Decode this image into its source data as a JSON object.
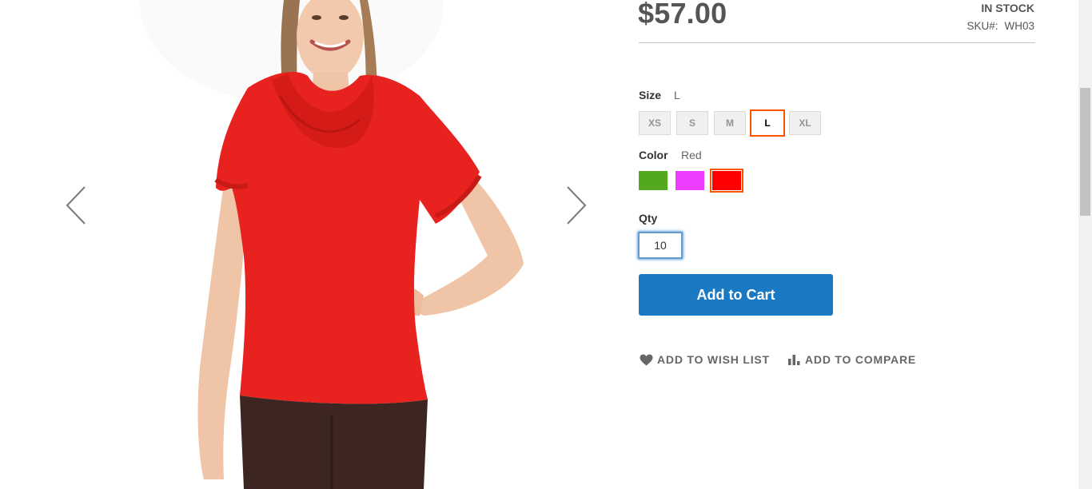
{
  "product": {
    "price": "$57.00",
    "stock_status": "IN STOCK",
    "sku_label": "SKU#:",
    "sku_value": "WH03"
  },
  "gallery": {
    "image_subject": "woman-red-cowl-neck-top",
    "prev_icon": "chevron-left-icon",
    "next_icon": "chevron-right-icon"
  },
  "options": {
    "size": {
      "label": "Size",
      "selected": "L",
      "choices": [
        "XS",
        "S",
        "M",
        "L",
        "XL"
      ]
    },
    "color": {
      "label": "Color",
      "selected": "Red",
      "choices": [
        {
          "name": "green",
          "hex": "#53a81e"
        },
        {
          "name": "purple",
          "hex": "#ef3dff"
        },
        {
          "name": "red",
          "hex": "#ff0000"
        }
      ]
    }
  },
  "qty": {
    "label": "Qty",
    "value": "10"
  },
  "actions": {
    "add_to_cart": "Add to Cart",
    "wishlist": "Add to Wish List",
    "compare": "Add to Compare",
    "wishlist_icon": "heart-icon",
    "compare_icon": "bar-chart-icon"
  },
  "colors": {
    "accent": "#1979c3",
    "selected_border": "#ff5501",
    "shirt": "#e8231f"
  }
}
